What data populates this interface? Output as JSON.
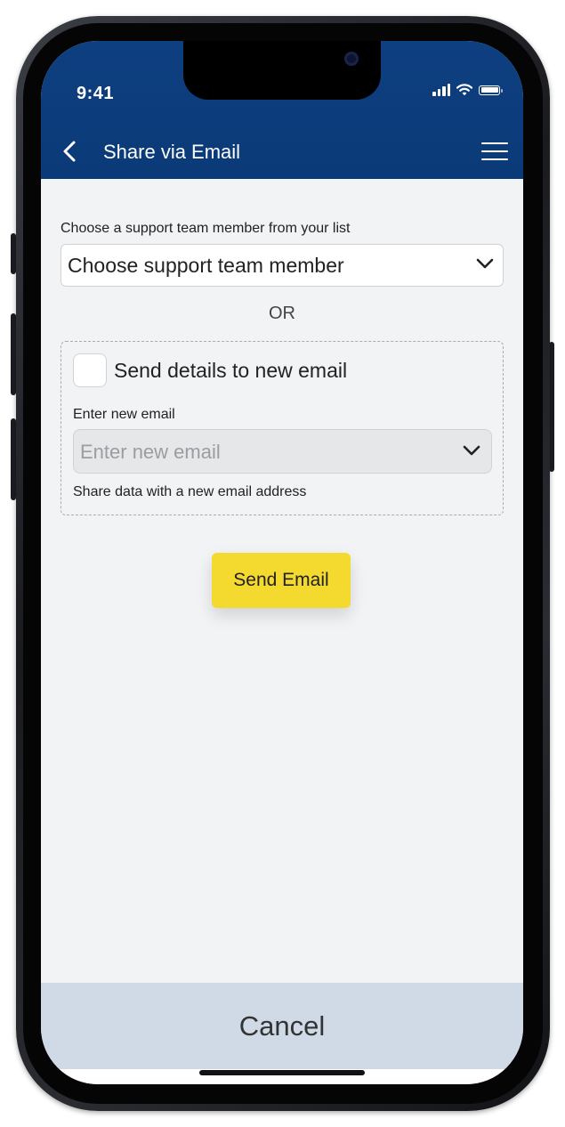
{
  "status_bar": {
    "time": "9:41"
  },
  "header": {
    "title": "Share via Email"
  },
  "support_member": {
    "label": "Choose a support team member from your list",
    "selected": "Choose support team member"
  },
  "separator": "OR",
  "new_email": {
    "checkbox_label": "Send details to new email",
    "field_label": "Enter new email",
    "placeholder": "Enter new email",
    "helper": "Share data with a new email address"
  },
  "actions": {
    "send": "Send Email",
    "cancel": "Cancel"
  },
  "colors": {
    "header_bg": "#0b3a78",
    "primary_button": "#f4d92e",
    "cancel_bar": "#cfdae6",
    "screen_bg": "#f2f3f5"
  },
  "icons": {
    "back": "chevron-left-icon",
    "menu": "hamburger-menu-icon",
    "dropdown": "chevron-down-icon",
    "signal": "cellular-signal-icon",
    "wifi": "wifi-icon",
    "battery": "battery-icon"
  }
}
